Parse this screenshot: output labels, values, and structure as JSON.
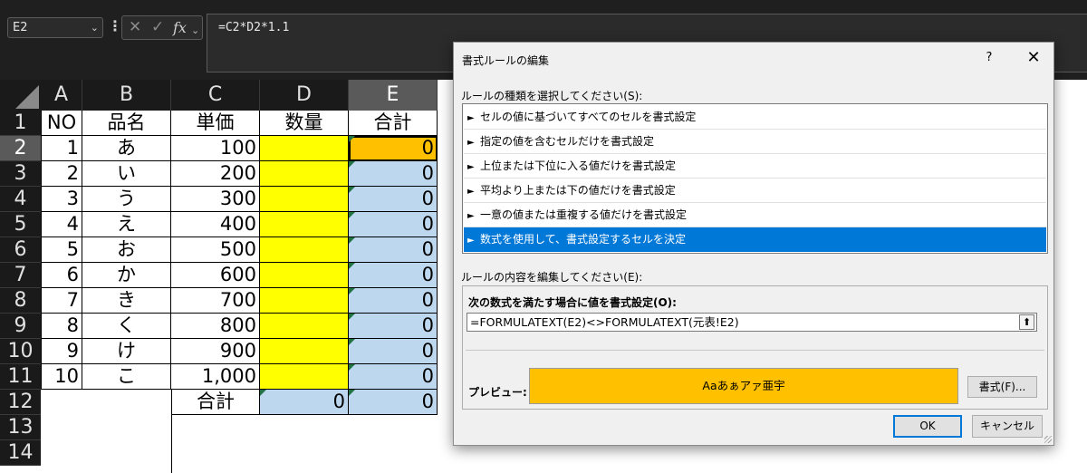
{
  "formula_bar": {
    "name_box": "E2",
    "dropdown_glyph": "⌄",
    "separator_glyph": "⋮",
    "cancel_glyph": "✕",
    "enter_glyph": "✓",
    "fx_glyph": "fx",
    "formula": "=C2*D2*1.1"
  },
  "sheet": {
    "columns": [
      "A",
      "B",
      "C",
      "D",
      "E"
    ],
    "rows": [
      "1",
      "2",
      "3",
      "4",
      "5",
      "6",
      "7",
      "8",
      "9",
      "10",
      "11",
      "12",
      "13",
      "14"
    ],
    "selected_column": "E",
    "selected_row": "2",
    "header_row": {
      "no": "NO",
      "name": "品名",
      "price": "単価",
      "qty": "数量",
      "total": "合計"
    },
    "data_rows": [
      {
        "no": "1",
        "name": "あ",
        "price": "100",
        "total": "0"
      },
      {
        "no": "2",
        "name": "い",
        "price": "200",
        "total": "0"
      },
      {
        "no": "3",
        "name": "う",
        "price": "300",
        "total": "0"
      },
      {
        "no": "4",
        "name": "え",
        "price": "400",
        "total": "0"
      },
      {
        "no": "5",
        "name": "お",
        "price": "500",
        "total": "0"
      },
      {
        "no": "6",
        "name": "か",
        "price": "600",
        "total": "0"
      },
      {
        "no": "7",
        "name": "き",
        "price": "700",
        "total": "0"
      },
      {
        "no": "8",
        "name": "く",
        "price": "800",
        "total": "0"
      },
      {
        "no": "9",
        "name": "け",
        "price": "900",
        "total": "0"
      },
      {
        "no": "10",
        "name": "こ",
        "price": "1,000",
        "total": "0"
      }
    ],
    "summary_row": {
      "label": "合計",
      "qty_total": "0",
      "total": "0"
    },
    "colors": {
      "qty_fill": "#ffff00",
      "total_fill": "#bdd7ee",
      "highlight_fill": "#ffc000"
    }
  },
  "dialog": {
    "title": "書式ルールの編集",
    "help": "?",
    "close": "✕",
    "rule_type_label": "ルールの種類を選択してください(S):",
    "rule_types": [
      "セルの値に基づいてすべてのセルを書式設定",
      "指定の値を含むセルだけを書式設定",
      "上位または下位に入る値だけを書式設定",
      "平均より上または下の値だけを書式設定",
      "一意の値または重複する値だけを書式設定",
      "数式を使用して、書式設定するセルを決定"
    ],
    "rule_arrow": "►",
    "selected_rule_index": 5,
    "edit_label": "ルールの内容を編集してください(E):",
    "condition_label": "次の数式を満たす場合に値を書式設定(O):",
    "condition_formula": "=FORMULATEXT(E2)<>FORMULATEXT(元表!E2)",
    "collapse_glyph": "⬆",
    "preview_label": "プレビュー:",
    "preview_text": "Aaあぁアァ亜宇",
    "format_button": "書式(F)...",
    "ok_button": "OK",
    "cancel_button": "キャンセル",
    "accent_color": "#0078d7"
  }
}
